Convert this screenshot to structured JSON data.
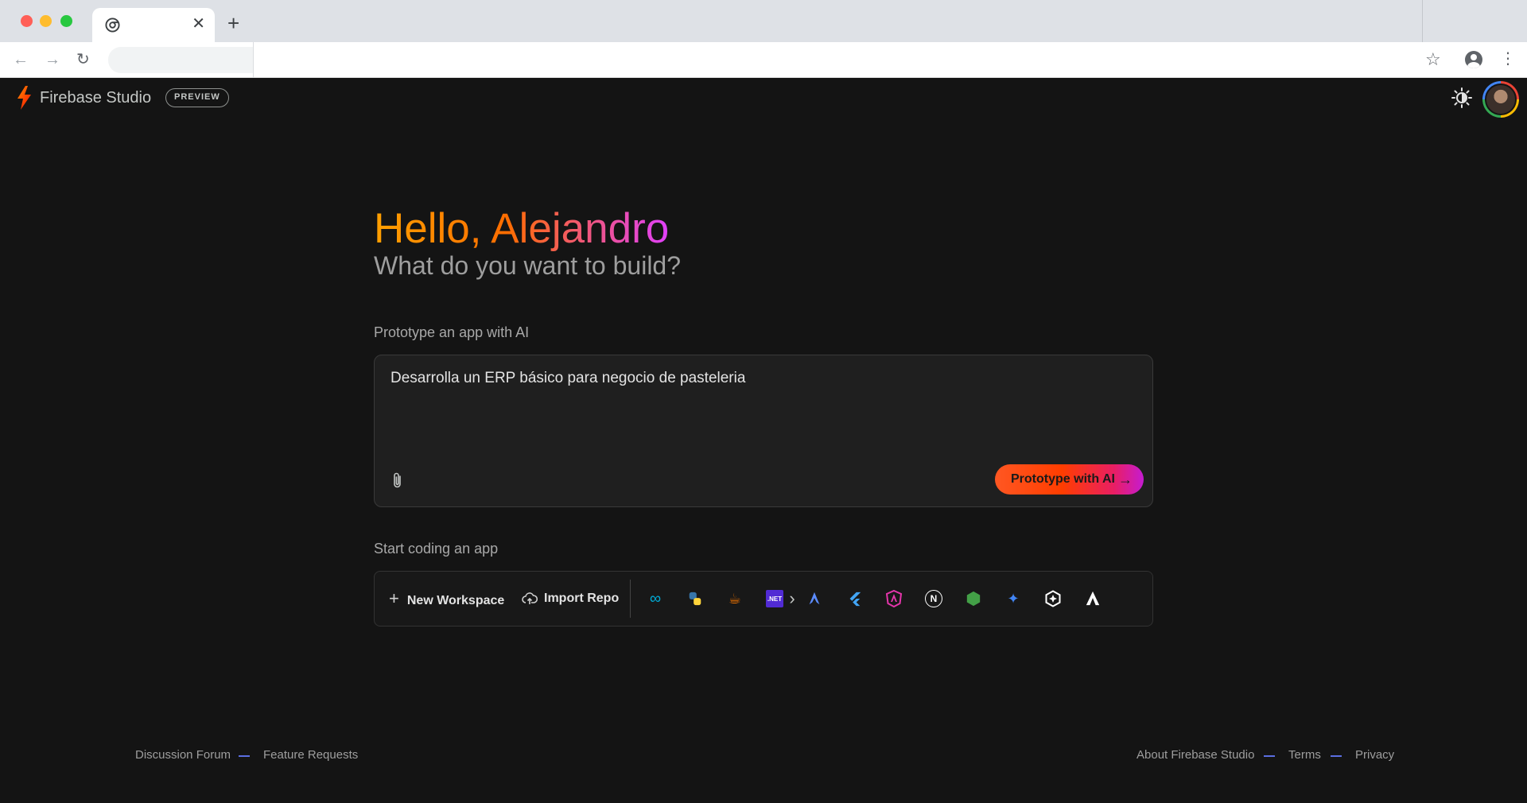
{
  "browser": {
    "tab_close": "✕",
    "new_tab": "+",
    "nav_back": "←",
    "nav_forward": "→",
    "nav_reload": "↻",
    "bookmark": "☆",
    "menu": "⋮"
  },
  "header": {
    "brand": "Firebase Studio",
    "badge": "PREVIEW"
  },
  "greeting": {
    "hello": "Hello, Alejandro",
    "subheading": "What do you want to build?"
  },
  "prototype": {
    "section_label": "Prototype an app with AI",
    "prompt_value": "Desarrolla un ERP básico para negocio de pasteleria",
    "button_label": "Prototype with AI",
    "button_arrow": "→"
  },
  "coding": {
    "section_label": "Start coding an app",
    "new_workspace": "New Workspace",
    "new_workspace_icon": "+",
    "import_repo": "Import Repo",
    "templates": [
      {
        "icon": "go-icon",
        "glyph": "∞",
        "color": "#00acd7"
      },
      {
        "icon": "python-icon",
        "glyph": "",
        "color": "#ffd43b"
      },
      {
        "icon": "java-icon",
        "glyph": "☕",
        "color": "#e76f00"
      },
      {
        "icon": "dotnet-icon",
        "glyph": ".NET",
        "color": "#512bd4"
      },
      {
        "icon": "astro-icon",
        "glyph": "",
        "color": "#5b8cff"
      },
      {
        "icon": "flutter-icon",
        "glyph": "",
        "color": "#42a5f5"
      },
      {
        "icon": "angular-icon",
        "glyph": "",
        "color": "#e535ab"
      },
      {
        "icon": "nextjs-icon",
        "glyph": "N",
        "color": "#ffffff"
      },
      {
        "icon": "nodejs-icon",
        "glyph": "",
        "color": "#43a047"
      },
      {
        "icon": "gemini-icon",
        "glyph": "✦",
        "color": "#4285f4"
      },
      {
        "icon": "hexagon-icon",
        "glyph": "",
        "color": "#ffffff"
      },
      {
        "icon": "analog-icon",
        "glyph": "",
        "color": "#ffffff"
      },
      {
        "icon": "mongodb-icon",
        "glyph": "",
        "color": "#13aa52"
      }
    ],
    "scroll_right": "›"
  },
  "footer": {
    "discussion_forum": "Discussion Forum",
    "feature_requests": "Feature Requests",
    "about": "About Firebase Studio",
    "terms": "Terms",
    "privacy": "Privacy"
  },
  "colors": {
    "background": "#141414",
    "accent_gradient_start": "#ff5722",
    "accent_gradient_end": "#c51cd1",
    "footer_dash": "#5b6ee1"
  }
}
